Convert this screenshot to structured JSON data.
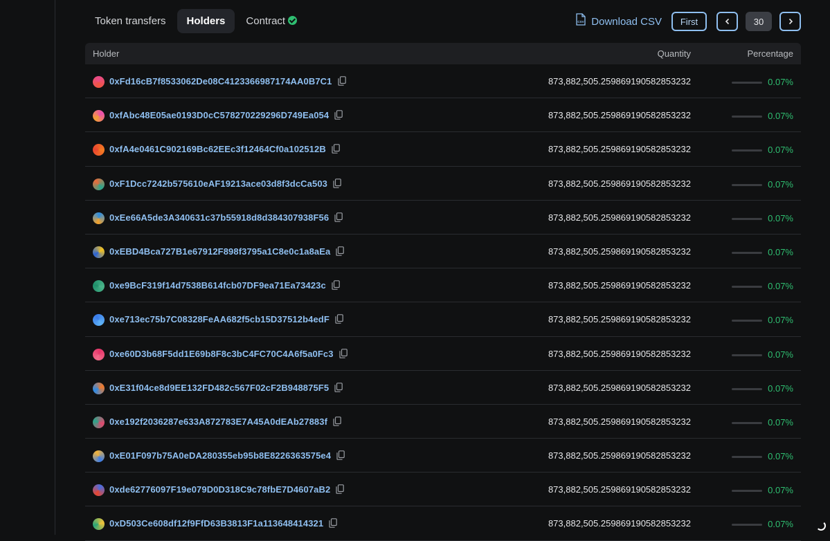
{
  "tabs": [
    {
      "label": "Token transfers",
      "active": false
    },
    {
      "label": "Holders",
      "active": true
    },
    {
      "label": "Contract",
      "active": false,
      "verified": true
    }
  ],
  "toolbar": {
    "download_label": "Download CSV",
    "csv_icon_text": "CSV",
    "first_label": "First",
    "page": "30"
  },
  "table": {
    "headers": {
      "holder": "Holder",
      "quantity": "Quantity",
      "percentage": "Percentage"
    },
    "rows": [
      {
        "address": "0xFd16cB7f8533062De08C4123366987174AA0B7C1",
        "quantity": "873,882,505.25986919058285323​2",
        "percentage": "0.07%",
        "fraction": 0.0007,
        "colors": [
          "#e84a8b",
          "#f0563f"
        ]
      },
      {
        "address": "0xfAbc48E05ae0193D0cC578270229296D749Ea054",
        "quantity": "873,882,505.259869190582853232",
        "percentage": "0.07%",
        "fraction": 0.0007,
        "colors": [
          "#ec4fb0",
          "#f3a033"
        ]
      },
      {
        "address": "0xfA4e0461C902169Bc62EEc3f12464Cf0a102512B",
        "quantity": "873,882,505.259869190582853232",
        "percentage": "0.07%",
        "fraction": 0.0007,
        "colors": [
          "#f37b22",
          "#e8442f"
        ]
      },
      {
        "address": "0xF1Dcc7242b575610eAF19213ace03d8f3dcCa503",
        "quantity": "873,882,505.259869190582853232",
        "percentage": "0.07%",
        "fraction": 0.0007,
        "colors": [
          "#2aa68c",
          "#e86b3a"
        ]
      },
      {
        "address": "0xEe66A5de3A340631c37b55918d8d384307938F56",
        "quantity": "873,882,505.259869190582853232",
        "percentage": "0.07%",
        "fraction": 0.0007,
        "colors": [
          "#f4a12a",
          "#2b8de0"
        ]
      },
      {
        "address": "0xEBD4Bca727B1e67912F898f3795a1C8e0c1a8aEa",
        "quantity": "873,882,505.259869190582853232",
        "percentage": "0.07%",
        "fraction": 0.0007,
        "colors": [
          "#2962d6",
          "#f4c21f"
        ]
      },
      {
        "address": "0xe9BcF319f14d7538B614fcb07DF9ea71Ea73423c",
        "quantity": "873,882,505.259869190582853232",
        "percentage": "0.07%",
        "fraction": 0.0007,
        "colors": [
          "#1f8f6a",
          "#4bb48a"
        ]
      },
      {
        "address": "0xe713ec75b7C08328FeAA682f5cb15D37512b4edF",
        "quantity": "873,882,505.259869190582853232",
        "percentage": "0.07%",
        "fraction": 0.0007,
        "colors": [
          "#3a7bea",
          "#5fb3f5"
        ]
      },
      {
        "address": "0xe60D3b68F5dd1E69b8F8c3bC4FC70C4A6f5a0Fc3",
        "quantity": "873,882,505.259869190582853232",
        "percentage": "0.07%",
        "fraction": 0.0007,
        "colors": [
          "#e6356a",
          "#f06b8a"
        ]
      },
      {
        "address": "0xE31f04ce8d9EE132FD482c567F02cF2B948875F5",
        "quantity": "873,882,505.259869190582853232",
        "percentage": "0.07%",
        "fraction": 0.0007,
        "colors": [
          "#f07a2c",
          "#2c8ae6"
        ]
      },
      {
        "address": "0xe192f2036287e633A872783E7A45A0dEAb27883f",
        "quantity": "873,882,505.259869190582853232",
        "percentage": "0.07%",
        "fraction": 0.0007,
        "colors": [
          "#e2486d",
          "#2ca58a"
        ]
      },
      {
        "address": "0xE01F097b75A0eDA280355eb95b8E8226363575e4",
        "quantity": "873,882,505.259869190582853232",
        "percentage": "0.07%",
        "fraction": 0.0007,
        "colors": [
          "#3d7ee8",
          "#f2b33a"
        ]
      },
      {
        "address": "0xde62776097F19e079D0D318C9c78fbE7D4607aB2",
        "quantity": "873,882,505.259869190582853232",
        "percentage": "0.07%",
        "fraction": 0.0007,
        "colors": [
          "#e8462f",
          "#4a6de0"
        ]
      },
      {
        "address": "0xD503Ce608df12f9FfD63B3813F1a113648414321",
        "quantity": "873,882,505.259869190582853232",
        "percentage": "0.07%",
        "fraction": 0.0007,
        "colors": [
          "#2aa678",
          "#f0c23a"
        ]
      }
    ]
  },
  "colors": {
    "accent": "#8fbff0",
    "positive": "#2fbf71",
    "background": "#101112"
  }
}
